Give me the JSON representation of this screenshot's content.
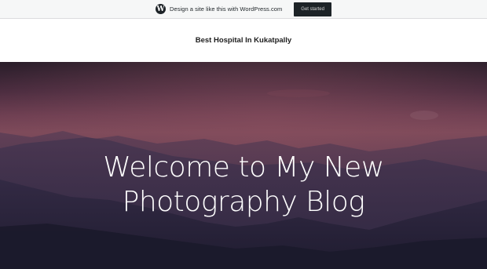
{
  "wp_banner": {
    "logo_glyph": "W",
    "text": "Design a site like this with WordPress.com",
    "cta_label": "Get started"
  },
  "site": {
    "title": "Best Hospital In Kukatpally"
  },
  "hero": {
    "title_line1": "Welcome to My New",
    "title_line2": "Photography Blog"
  },
  "colors": {
    "banner_bg": "#f6f7f7",
    "cta_bg": "#1d2327",
    "hero_sky_top": "#2a1e2a",
    "hero_sky_mid": "#7d4a5a",
    "hero_mountains": "#2a2440"
  }
}
